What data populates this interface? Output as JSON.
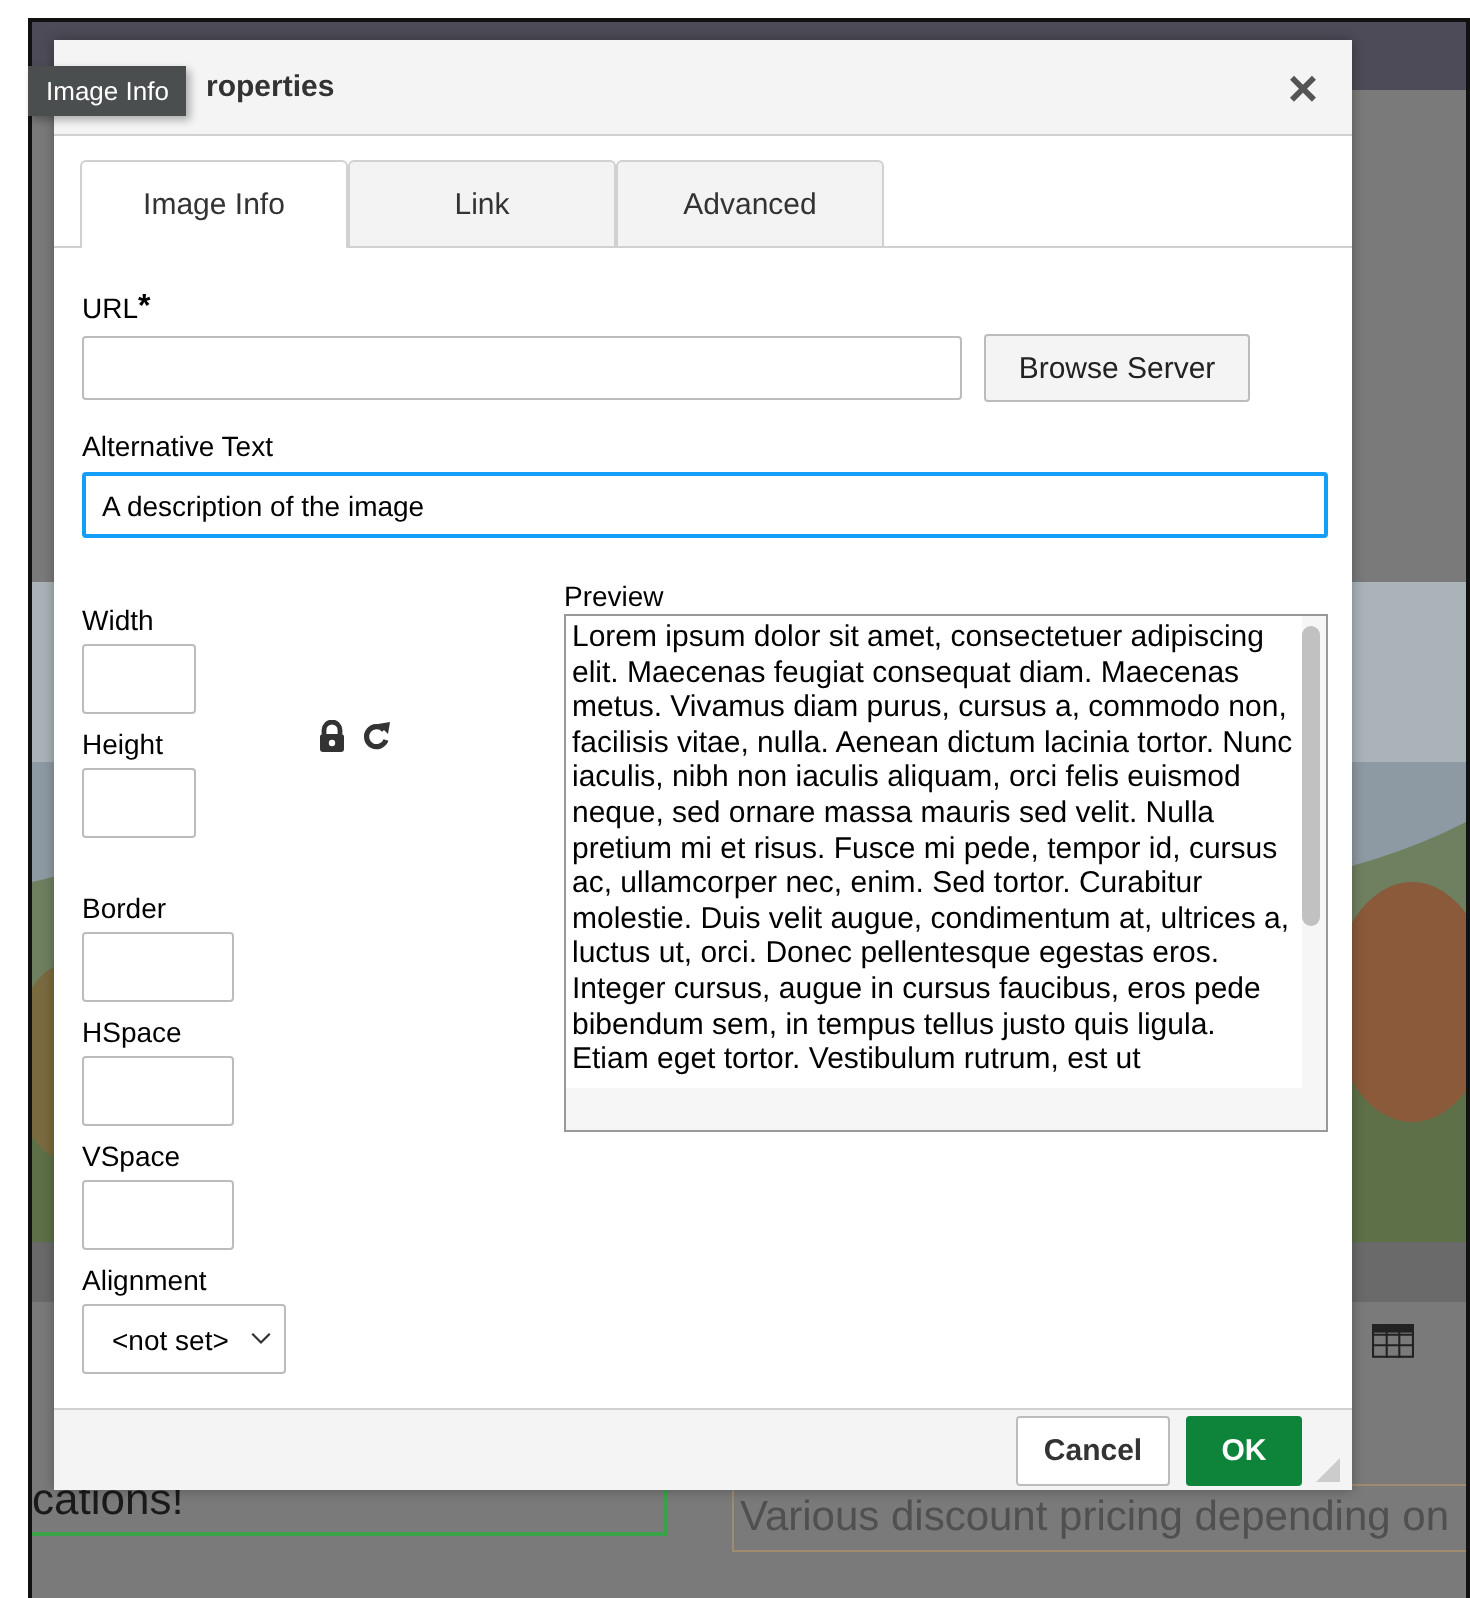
{
  "tooltip": "Image Info",
  "dialog": {
    "title": "roperties",
    "close": "×",
    "tabs": [
      {
        "label": "Image Info",
        "selected": true
      },
      {
        "label": "Link",
        "selected": false
      },
      {
        "label": "Advanced",
        "selected": false
      }
    ],
    "url": {
      "label": "URL",
      "required_mark": "*"
    },
    "browse_button": "Browse Server",
    "alt_text": {
      "label": "Alternative Text",
      "value": "A description of the image",
      "focused": true
    },
    "size_fields": [
      {
        "label": "Width"
      },
      {
        "label": "Height"
      }
    ],
    "spacing_fields": [
      {
        "label": "Border"
      },
      {
        "label": "HSpace"
      },
      {
        "label": "VSpace"
      }
    ],
    "alignment": {
      "label": "Alignment",
      "value": "<not set>"
    },
    "preview": {
      "label": "Preview",
      "text": "Lorem ipsum dolor sit amet, consectetuer adipiscing elit. Maecenas feugiat consequat diam. Maecenas metus. Vivamus diam purus, cursus a, commodo non, facilisis vitae, nulla. Aenean dictum lacinia tortor. Nunc iaculis, nibh non iaculis aliquam, orci felis euismod neque, sed ornare massa mauris sed velit. Nulla pretium mi et risus. Fusce mi pede, tempor id, cursus ac, ullamcorper nec, enim. Sed tortor. Curabitur molestie. Duis velit augue, condimentum at, ultrices a, luctus ut, orci. Donec pellentesque egestas eros. Integer cursus, augue in cursus faucibus, eros pede bibendum sem, in tempus tellus justo quis ligula. Etiam eget tortor. Vestibulum rutrum, est ut"
    },
    "buttons": [
      {
        "label": "Cancel",
        "kind": "secondary"
      },
      {
        "label": "OK",
        "kind": "primary"
      }
    ]
  },
  "background": {
    "field_1": "cations!",
    "field_2": "Various discount pricing depending on"
  }
}
